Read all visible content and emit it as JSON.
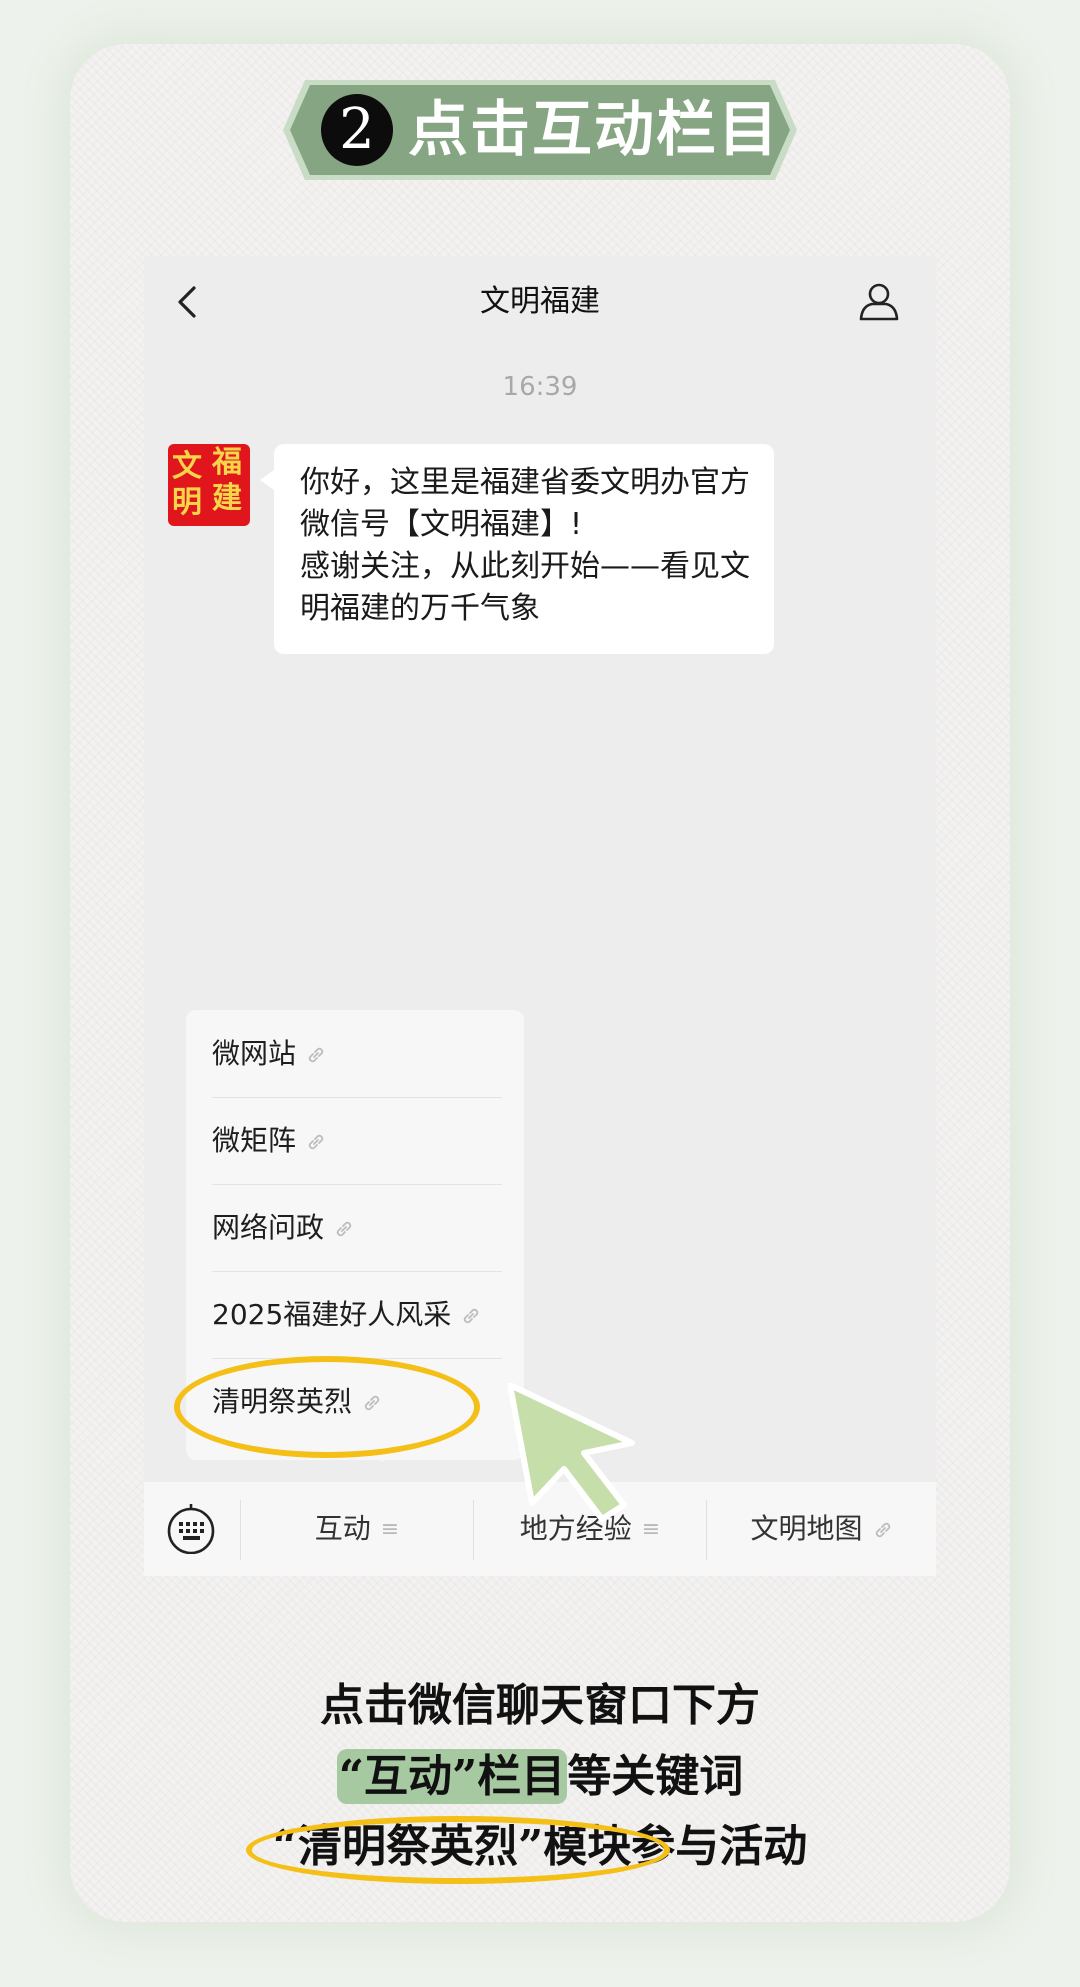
{
  "banner": {
    "step": "2",
    "title": "点击互动栏目",
    "color": "#86a583"
  },
  "chat": {
    "title": "文明福建",
    "time": "16:39",
    "avatar_chars": [
      "文",
      "福",
      "明",
      "建"
    ],
    "message": "你好，这里是福建省委文明办官方微信号【文明福建】!\n感谢关注，从此刻开始——看见文明福建的万千气象"
  },
  "menu": {
    "items": [
      {
        "label": "微网站",
        "icon": "link-icon"
      },
      {
        "label": "微矩阵",
        "icon": "link-icon"
      },
      {
        "label": "网络问政",
        "icon": "link-icon"
      },
      {
        "label": "2025福建好人风采",
        "icon": "link-icon"
      },
      {
        "label": "清明祭英烈",
        "icon": "link-icon"
      }
    ]
  },
  "bottom_bar": {
    "tabs": [
      {
        "label": "互动",
        "icon": "submenu-icon"
      },
      {
        "label": "地方经验",
        "icon": "submenu-icon"
      },
      {
        "label": "文明地图",
        "icon": "link-icon"
      }
    ]
  },
  "caption": {
    "line1": "点击微信聊天窗口下方",
    "line2_hl": "“互动”栏目",
    "line2_rest": "等关键词",
    "line3": "“清明祭英烈”模块参与活动"
  },
  "colors": {
    "highlight": "#a7c9a2",
    "ring": "#f4bf17",
    "cursor": "#c6dfaa"
  }
}
